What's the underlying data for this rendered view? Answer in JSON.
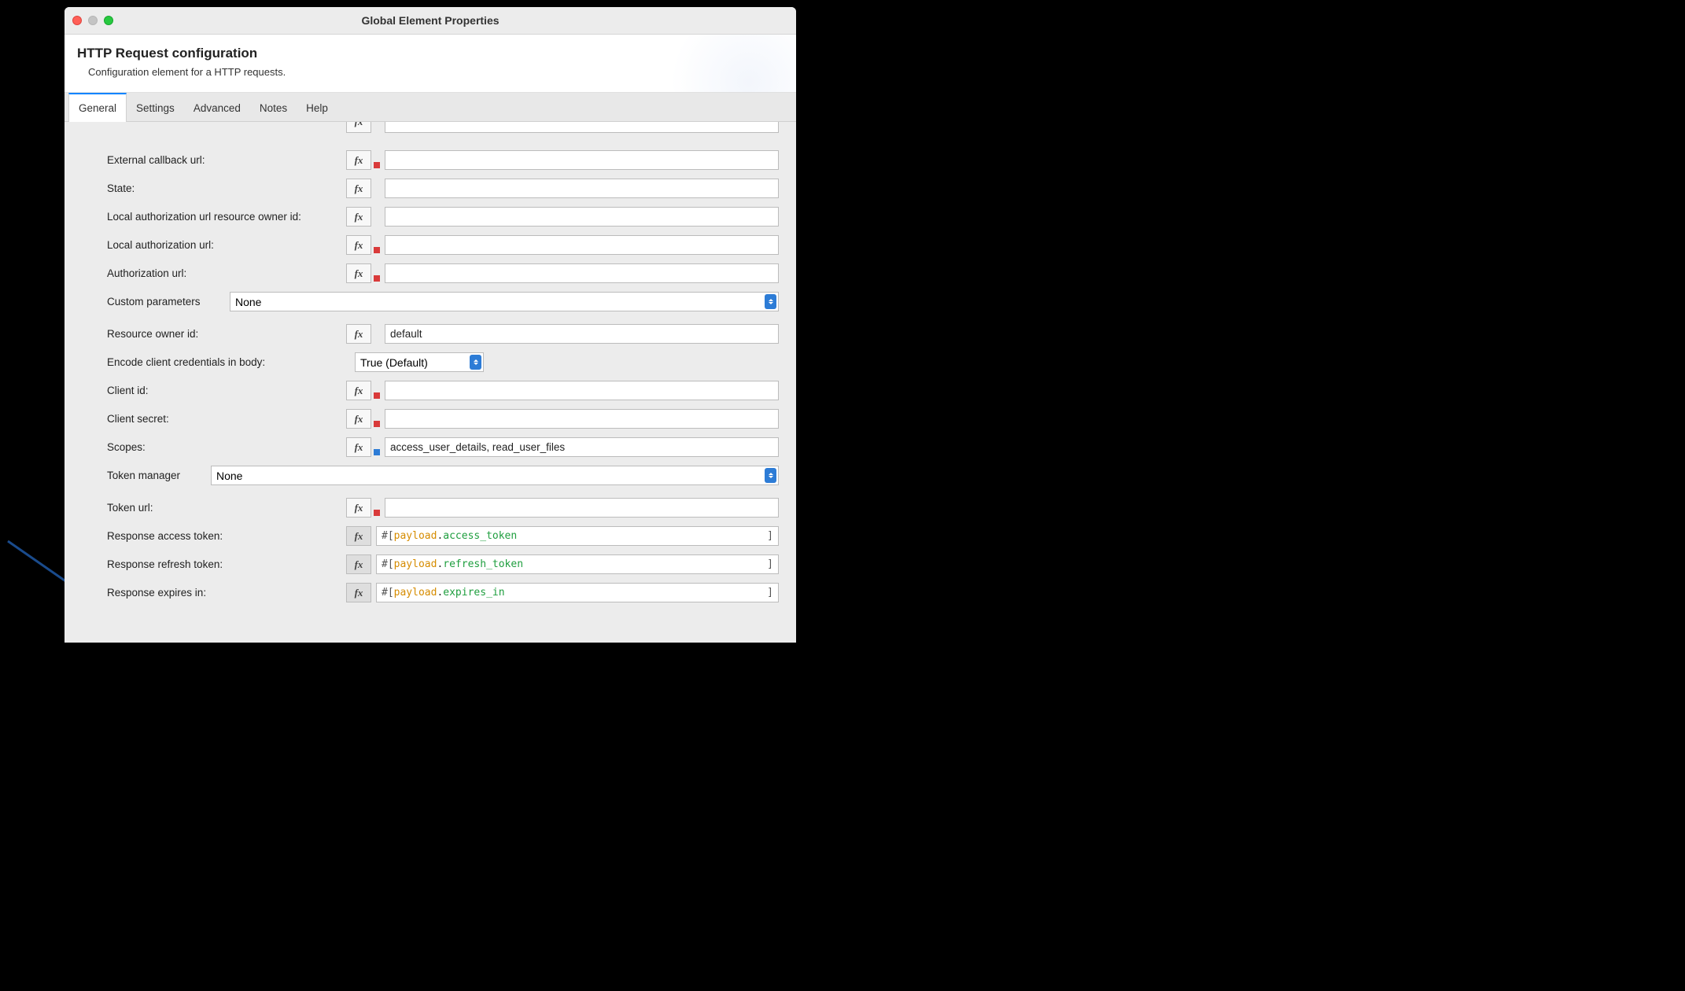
{
  "window": {
    "title": "Global Element Properties"
  },
  "header": {
    "title": "HTTP Request configuration",
    "subtitle": "Configuration element for a HTTP requests."
  },
  "tabs": {
    "items": [
      {
        "label": "General",
        "active": true
      },
      {
        "label": "Settings",
        "active": false
      },
      {
        "label": "Advanced",
        "active": false
      },
      {
        "label": "Notes",
        "active": false
      },
      {
        "label": "Help",
        "active": false
      }
    ]
  },
  "fx_label": "fx",
  "fields": {
    "external_callback_url": {
      "label": "External callback url:",
      "value": ""
    },
    "state": {
      "label": "State:",
      "value": ""
    },
    "local_auth_url_owner_id": {
      "label": "Local authorization url resource owner id:",
      "value": ""
    },
    "local_auth_url": {
      "label": "Local authorization url:",
      "value": ""
    },
    "auth_url": {
      "label": "Authorization url:",
      "value": ""
    },
    "custom_parameters": {
      "label": "Custom parameters",
      "selected": "None"
    },
    "resource_owner_id": {
      "label": "Resource owner id:",
      "value": "default"
    },
    "encode_client_credentials": {
      "label": "Encode client credentials in body:",
      "selected": "True (Default)"
    },
    "client_id": {
      "label": "Client id:",
      "value": ""
    },
    "client_secret": {
      "label": "Client secret:",
      "value": ""
    },
    "scopes": {
      "label": "Scopes:",
      "value": "access_user_details, read_user_files"
    },
    "token_manager": {
      "label": "Token manager",
      "selected": "None"
    },
    "token_url": {
      "label": "Token url:",
      "value": ""
    },
    "response_access_token": {
      "label": "Response access token:",
      "expr_prefix": "#[ ",
      "expr_payload": "payload",
      "expr_dot": ".",
      "expr_prop": "access_token",
      "expr_suffix": "]"
    },
    "response_refresh_token": {
      "label": "Response refresh token:",
      "expr_prefix": "#[ ",
      "expr_payload": "payload",
      "expr_dot": ".",
      "expr_prop": "refresh_token",
      "expr_suffix": "]"
    },
    "response_expires_in": {
      "label": "Response expires in:",
      "expr_prefix": "#[ ",
      "expr_payload": "payload",
      "expr_dot": ".",
      "expr_prop": "expires_in",
      "expr_suffix": "]"
    }
  }
}
